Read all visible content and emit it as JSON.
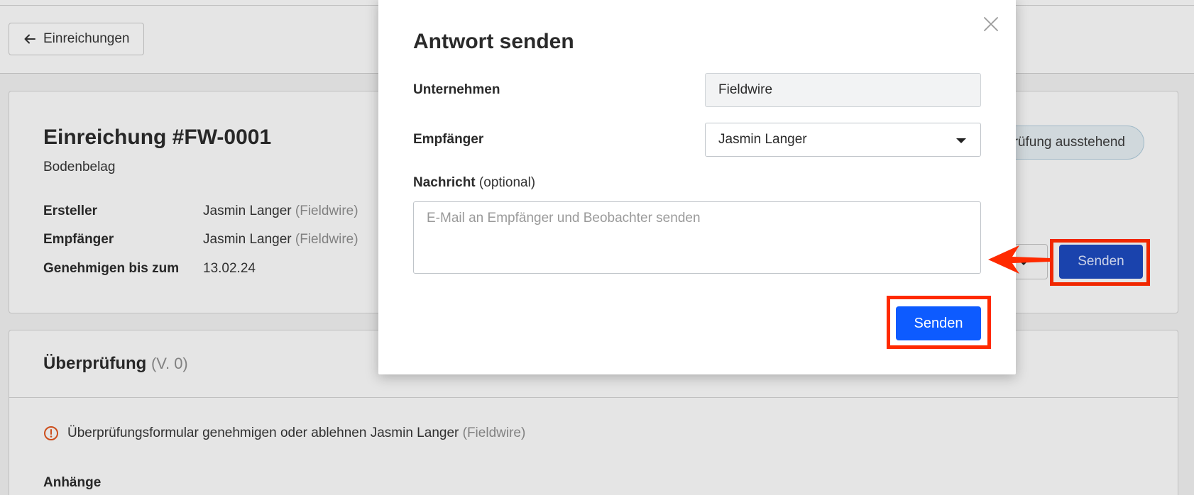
{
  "background": {
    "back_button_label": "Einreichungen",
    "submission_title": "Einreichung #FW-0001",
    "submission_type": "Bodenbelag",
    "status_badge": "Überprüfung ausstehend",
    "meta": [
      {
        "label": "Ersteller",
        "value": "Jasmin Langer",
        "company": "(Fieldwire)"
      },
      {
        "label": "Empfänger",
        "value": "Jasmin Langer",
        "company": "(Fieldwire)"
      },
      {
        "label": "Genehmigen bis zum",
        "value": "13.02.24",
        "company": ""
      }
    ],
    "send_button_label": "Senden",
    "review": {
      "title": "Überprüfung",
      "version": "(V. 0)",
      "notice_text": "Überprüfungsformular genehmigen oder ablehnen Jasmin Langer",
      "notice_company": "(Fieldwire)",
      "attachments_label": "Anhänge"
    }
  },
  "modal": {
    "title": "Antwort senden",
    "company_label": "Unternehmen",
    "company_value": "Fieldwire",
    "recipient_label": "Empfänger",
    "recipient_value": "Jasmin Langer",
    "message_label": "Nachricht",
    "message_optional": "(optional)",
    "message_placeholder": "E-Mail an Empfänger und Beobachter senden",
    "send_button_label": "Senden"
  },
  "annotation": {
    "highlight_color": "#ff2a00"
  },
  "colors": {
    "primary_button": "#0d5bff",
    "background_send": "#1c48b8",
    "warning_icon": "#d9531e"
  }
}
